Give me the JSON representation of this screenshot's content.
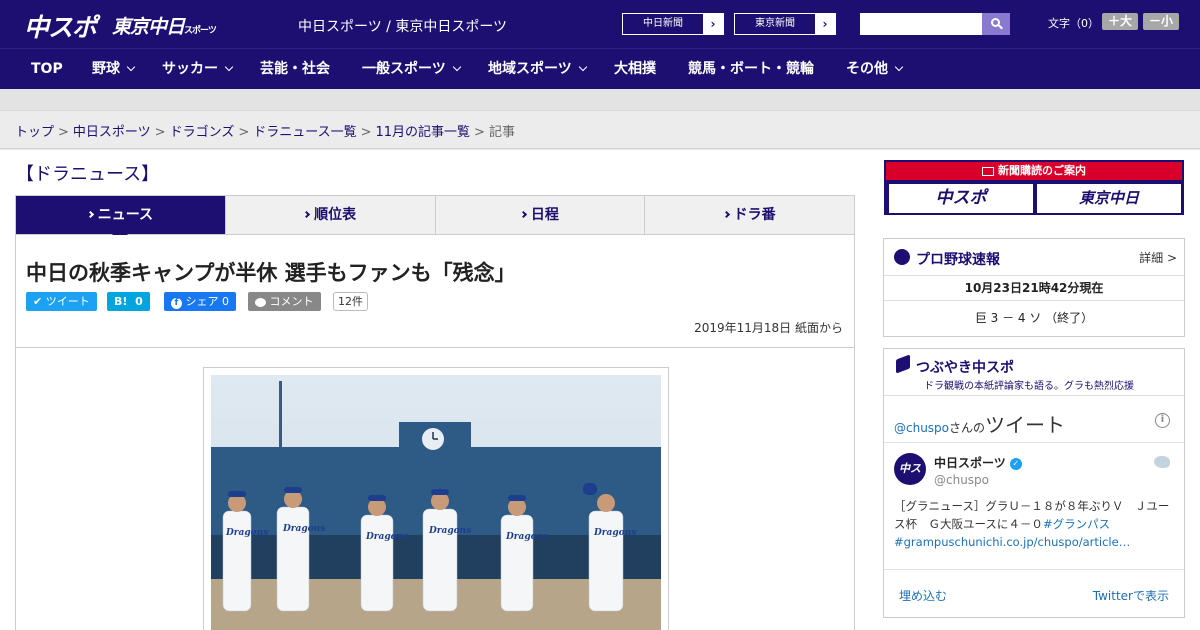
{
  "header": {
    "logo_chuspo": "中スポ",
    "logo_tokyo": "東京中日",
    "logo_tokyo_sub": "スポーツ",
    "site_names": "中日スポーツ / 東京中日スポーツ",
    "paper_buttons": [
      "中日新聞",
      "東京新聞"
    ],
    "search_placeholder": "",
    "font_size_label": "文字（0）",
    "font_larger": "＋大",
    "font_smaller": "－小"
  },
  "nav": {
    "items": [
      {
        "label": "TOP",
        "dropdown": false
      },
      {
        "label": "野球",
        "dropdown": true
      },
      {
        "label": "サッカー",
        "dropdown": true
      },
      {
        "label": "芸能・社会",
        "dropdown": false
      },
      {
        "label": "一般スポーツ",
        "dropdown": true
      },
      {
        "label": "地域スポーツ",
        "dropdown": true
      },
      {
        "label": "大相撲",
        "dropdown": false
      },
      {
        "label": "競馬・ボート・競輪",
        "dropdown": false
      },
      {
        "label": "その他",
        "dropdown": true
      }
    ]
  },
  "breadcrumb": {
    "links": [
      "トップ",
      "中日スポーツ",
      "ドラゴンズ",
      "ドラニュース一覧",
      "11月の記事一覧"
    ],
    "current": "記事",
    "separator": ">"
  },
  "section": {
    "title": "【ドラニュース】"
  },
  "tabs": [
    {
      "label": "ニュース",
      "active": true
    },
    {
      "label": "順位表",
      "active": false
    },
    {
      "label": "日程",
      "active": false
    },
    {
      "label": "ドラ番",
      "active": false
    }
  ],
  "article": {
    "headline": "中日の秋季キャンプが半休 選手もファンも「残念」",
    "share": {
      "tweet": "ツイート",
      "hatena_label": "B!",
      "hatena_count": "0",
      "facebook": "シェア 0",
      "comment": "コメント",
      "comment_count": "12件"
    },
    "date": "2019年11月18日 紙面から"
  },
  "sidebar": {
    "ad": {
      "header": "新聞購読のご案内",
      "logo_left": "中スポ",
      "logo_right": "東京中日"
    },
    "baseball": {
      "title": "プロ野球速報",
      "more": "詳細 >",
      "timestamp": "10月23日21時42分現在",
      "score": "巨 3 － 4 ソ （終了）"
    },
    "twitter": {
      "title": "つぶやき中スポ",
      "subtitle": "ドラ観戦の本紙評論家も語る。グラも熱烈応援",
      "handle": "@chuspo",
      "handle_suffix": "さんの",
      "tweets_label": "ツイート",
      "account_name": "中日スポーツ",
      "account_handle": "@chuspo",
      "avatar_text": "中スポ",
      "tweet_text": "［グラニュース］グラＵ－１８が８年ぶりＶ　Ｊユース杯　Ｇ大阪ユースに４－０",
      "tweet_hashtag": "#グランパス",
      "tweet_link": "#grampuschunichi.co.jp/chuspo/article…",
      "embed": "埋め込む",
      "view_on_twitter": "Twitterで表示"
    }
  },
  "colors": {
    "brand": "#1d0f72",
    "accent_red": "#d8002a",
    "twitter_blue": "#1da1f2",
    "facebook_blue": "#1877f2"
  }
}
